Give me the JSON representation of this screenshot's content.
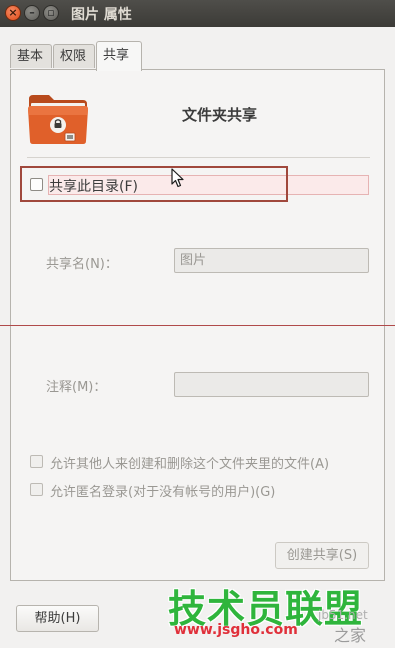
{
  "window": {
    "title": "图片 属性",
    "close_glyph": "×",
    "min_glyph": "–",
    "max_glyph": "▫"
  },
  "tabs": [
    {
      "label": "基本",
      "active": false
    },
    {
      "label": "权限",
      "active": false
    },
    {
      "label": "共享",
      "active": true
    }
  ],
  "share_page": {
    "heading": "文件夹共享",
    "folder_icon": "folder-share-icon",
    "share_checkbox_label": "共享此目录(F)",
    "share_checked": false,
    "share_name_label": "共享名(N)：",
    "share_name_value": "图片",
    "comment_label": "注释(M)：",
    "comment_value": "",
    "allow_others_label": "允许其他人来创建和删除这个文件夹里的文件(A)",
    "allow_guest_label": "允许匿名登录(对于没有帐号的用户)(G)",
    "create_share_button": "创建共享(S)"
  },
  "footer": {
    "help_button": "帮助(H)"
  },
  "watermark": {
    "brand": "技术员联盟",
    "url": "www.jsgho.com",
    "partial_site": "jb51.net",
    "partial_home": "之家"
  },
  "colors": {
    "accent_folder": "#e0602a",
    "highlight_box": "#a0483c",
    "watermark_green": "#2fb53c",
    "watermark_red": "#e0303a"
  }
}
